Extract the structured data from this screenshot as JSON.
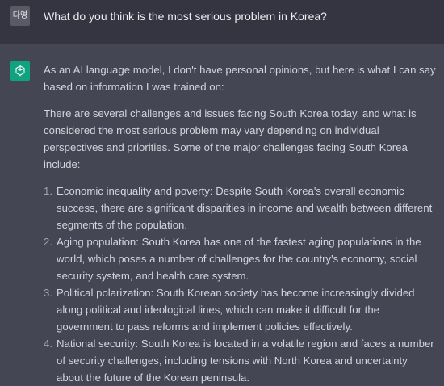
{
  "user": {
    "avatar_text": "다영",
    "message": "What do you think is the most serious problem in Korea?"
  },
  "assistant": {
    "paragraphs": [
      "As an AI language model, I don't have personal opinions, but here is what I can say based on information I was trained on:",
      "There are several challenges and issues facing South Korea today, and what is considered the most serious problem may vary depending on individual perspectives and priorities. Some of the major challenges facing South Korea include:"
    ],
    "list": [
      {
        "num": "1.",
        "text": "Economic inequality and poverty: Despite South Korea's overall economic success, there are significant disparities in income and wealth between different segments of the population."
      },
      {
        "num": "2.",
        "text": "Aging population: South Korea has one of the fastest aging populations in the world, which poses a number of challenges for the country's economy, social security system, and health care system."
      },
      {
        "num": "3.",
        "text": "Political polarization: South Korean society has become increasingly divided along political and ideological lines, which can make it difficult for the government to pass reforms and implement policies effectively."
      },
      {
        "num": "4.",
        "text": "National security: South Korea is located in a volatile region and faces a number of security challenges, including tensions with North Korea and uncertainty about the future of the Korean peninsula."
      }
    ]
  },
  "colors": {
    "user_bg": "#343541",
    "assistant_bg": "#444654",
    "gpt_brand": "#10a37f"
  }
}
